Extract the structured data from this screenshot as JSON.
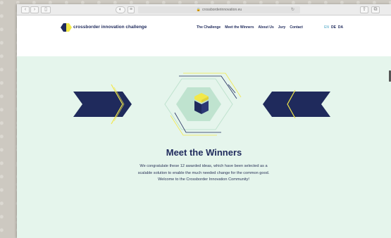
{
  "browser": {
    "url": "crossborderinnovation.eu"
  },
  "site": {
    "logo_text": "crossborder innovation challenge",
    "nav": [
      {
        "label": "The Challenge"
      },
      {
        "label": "Meet the Winners"
      },
      {
        "label": "About Us"
      },
      {
        "label": "Jury"
      },
      {
        "label": "Contact"
      }
    ],
    "languages": [
      "EN",
      "DE",
      "DA"
    ]
  },
  "hero": {
    "title": "Meet the Winners",
    "text": "We congratulate these 12 awarded ideas, which have been selected as a scalable solution to enable the much needed change for the common good. Welcome to the Crossborder Innovation Community!"
  },
  "colors": {
    "navy": "#1f2a5c",
    "mint": "#e5f5ec",
    "yellow": "#f2e84a",
    "lang_active": "#7fbfd6"
  },
  "icons": {
    "lock": "lock-icon",
    "reload": "reload-icon",
    "sidebar": "sidebar-icon",
    "share": "share-icon",
    "tabs": "tabs-icon"
  }
}
